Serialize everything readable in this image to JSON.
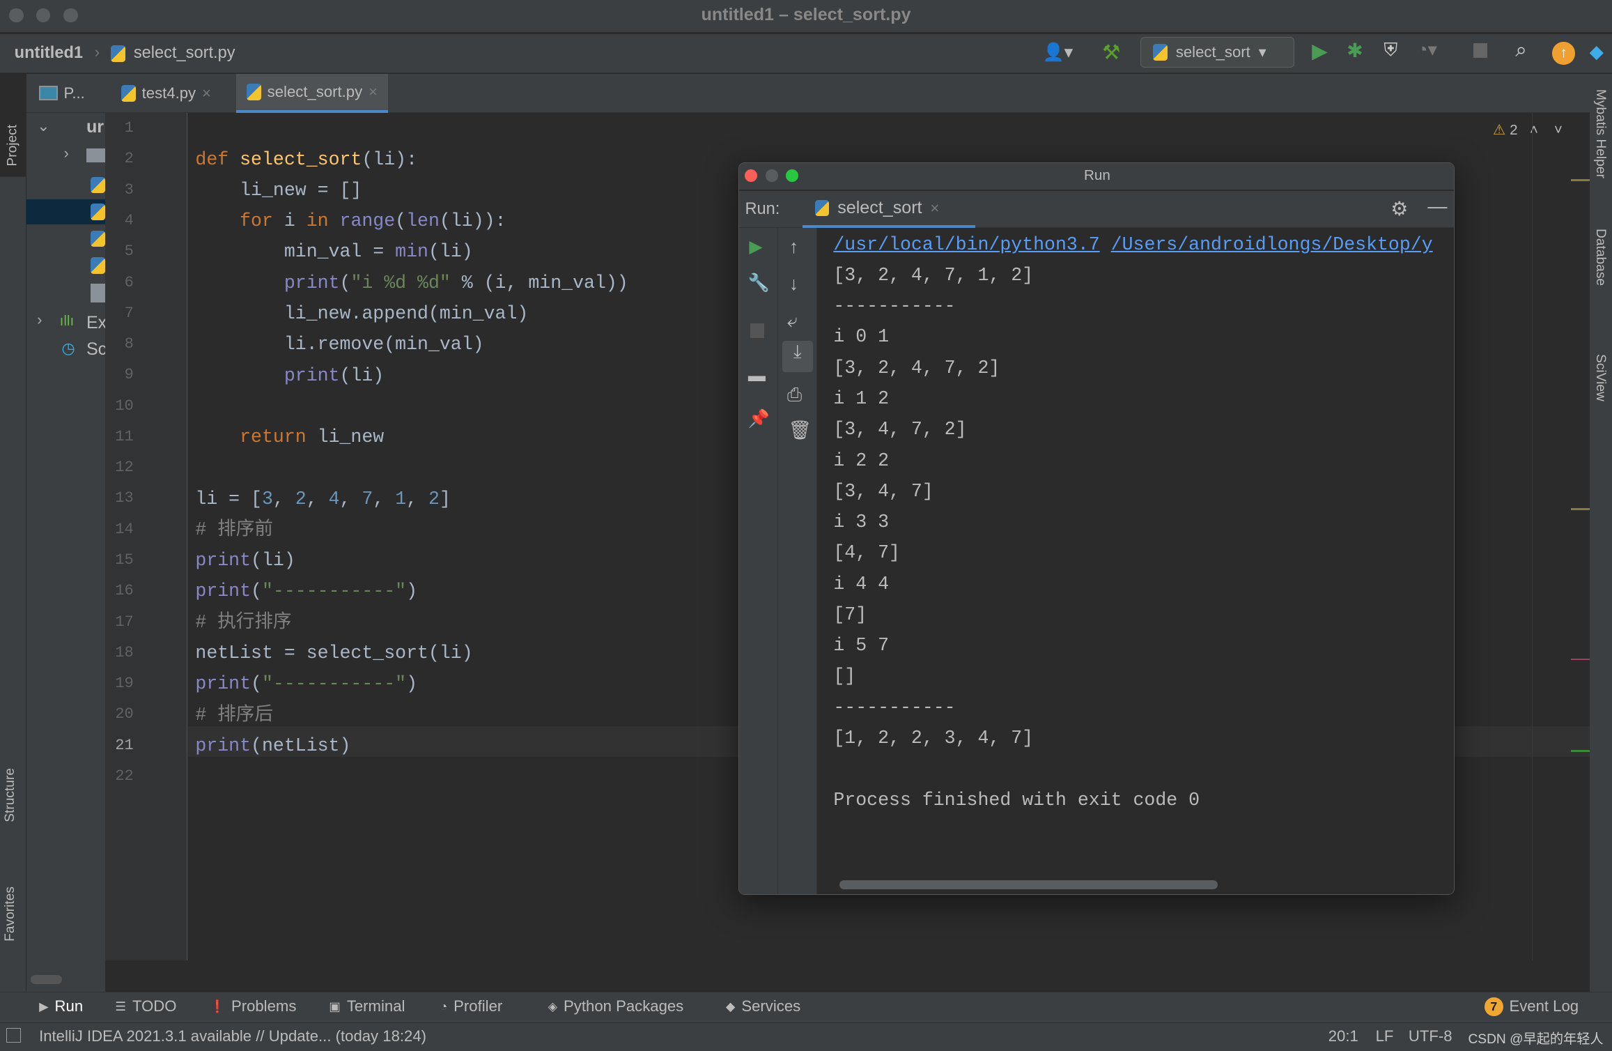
{
  "window": {
    "title": "untitled1 – select_sort.py"
  },
  "breadcrumb": {
    "project": "untitled1",
    "file": "select_sort.py"
  },
  "toolbar": {
    "run_config": "select_sort"
  },
  "side": {
    "project": "Project",
    "structure": "Structure",
    "favorites": "Favorites",
    "mybatis": "Mybatis Helper",
    "database": "Database",
    "sciview": "SciView"
  },
  "project_panel": {
    "label": "P...",
    "root": "ur",
    "ext": "Ex",
    "scratch": "Sc"
  },
  "tabs": [
    {
      "label": "test4.py"
    },
    {
      "label": "select_sort.py",
      "active": true
    }
  ],
  "inspection": {
    "warnings": "2"
  },
  "code": [
    [],
    [
      [
        "kw",
        "def "
      ],
      [
        "fn",
        "select_sort"
      ],
      [
        "tx",
        "(li):"
      ]
    ],
    [
      [
        "tx",
        "    li_new = []"
      ]
    ],
    [
      [
        "kw",
        "    for "
      ],
      [
        "tx",
        "i "
      ],
      [
        "kw",
        "in "
      ],
      [
        "bi",
        "range"
      ],
      [
        "tx",
        "("
      ],
      [
        "bi",
        "len"
      ],
      [
        "tx",
        "(li)):"
      ]
    ],
    [
      [
        "tx",
        "        min_val = "
      ],
      [
        "bi",
        "min"
      ],
      [
        "tx",
        "(li)"
      ]
    ],
    [
      [
        "bi",
        "        print"
      ],
      [
        "tx",
        "("
      ],
      [
        "st",
        "\"i %d %d\""
      ],
      [
        "tx",
        " % (i, min_val))"
      ]
    ],
    [
      [
        "tx",
        "        li_new.append(min_val)"
      ]
    ],
    [
      [
        "tx",
        "        li.remove(min_val)"
      ]
    ],
    [
      [
        "bi",
        "        print"
      ],
      [
        "tx",
        "(li)"
      ]
    ],
    [],
    [
      [
        "kw",
        "    return "
      ],
      [
        "tx",
        "li_new"
      ]
    ],
    [],
    [
      [
        "tx",
        "li = ["
      ],
      [
        "nu",
        "3"
      ],
      [
        "tx",
        ", "
      ],
      [
        "nu",
        "2"
      ],
      [
        "tx",
        ", "
      ],
      [
        "nu",
        "4"
      ],
      [
        "tx",
        ", "
      ],
      [
        "nu",
        "7"
      ],
      [
        "tx",
        ", "
      ],
      [
        "nu",
        "1"
      ],
      [
        "tx",
        ", "
      ],
      [
        "nu",
        "2"
      ],
      [
        "tx",
        "]"
      ]
    ],
    [
      [
        "cm",
        "# 排序前"
      ]
    ],
    [
      [
        "bi",
        "print"
      ],
      [
        "tx",
        "(li)"
      ]
    ],
    [
      [
        "bi",
        "print"
      ],
      [
        "tx",
        "("
      ],
      [
        "st",
        "\"-----------\""
      ],
      [
        "tx",
        ")"
      ]
    ],
    [
      [
        "cm",
        "# 执行排序"
      ]
    ],
    [
      [
        "tx",
        "netList = select_sort(li)"
      ]
    ],
    [
      [
        "bi",
        "print"
      ],
      [
        "tx",
        "("
      ],
      [
        "st",
        "\"-----------\""
      ],
      [
        "tx",
        ")"
      ]
    ],
    [
      [
        "cm",
        "# 排序后"
      ]
    ],
    [
      [
        "bi",
        "print"
      ],
      [
        "tx",
        "(netList)"
      ]
    ],
    []
  ],
  "run_window": {
    "title": "Run",
    "run_label": "Run:",
    "tab": "select_sort",
    "cmd_python": "/usr/local/bin/python3.7",
    "cmd_script": "/Users/androidlongs/Desktop/y",
    "output": [
      "[3, 2, 4, 7, 1, 2]",
      "-----------",
      "i 0 1",
      "[3, 2, 4, 7, 2]",
      "i 1 2",
      "[3, 4, 7, 2]",
      "i 2 2",
      "[3, 4, 7]",
      "i 3 3",
      "[4, 7]",
      "i 4 4",
      "[7]",
      "i 5 7",
      "[]",
      "-----------",
      "[1, 2, 2, 3, 4, 7]",
      "",
      "Process finished with exit code 0"
    ]
  },
  "bottom_tabs": [
    {
      "label": "Run",
      "icon": "play-icon"
    },
    {
      "label": "TODO",
      "icon": "list-icon"
    },
    {
      "label": "Problems",
      "icon": "alert-icon"
    },
    {
      "label": "Terminal",
      "icon": "terminal-icon"
    },
    {
      "label": "Profiler",
      "icon": "profiler-icon"
    },
    {
      "label": "Python Packages",
      "icon": "packages-icon"
    },
    {
      "label": "Services",
      "icon": "services-icon"
    }
  ],
  "event_log": {
    "label": "Event Log",
    "count": "7"
  },
  "status": {
    "message": "IntelliJ IDEA 2021.3.1 available // Update... (today 18:24)",
    "position": "20:1",
    "line_sep": "LF",
    "encoding": "UTF-8",
    "watermark": "CSDN @早起的年轻人"
  }
}
